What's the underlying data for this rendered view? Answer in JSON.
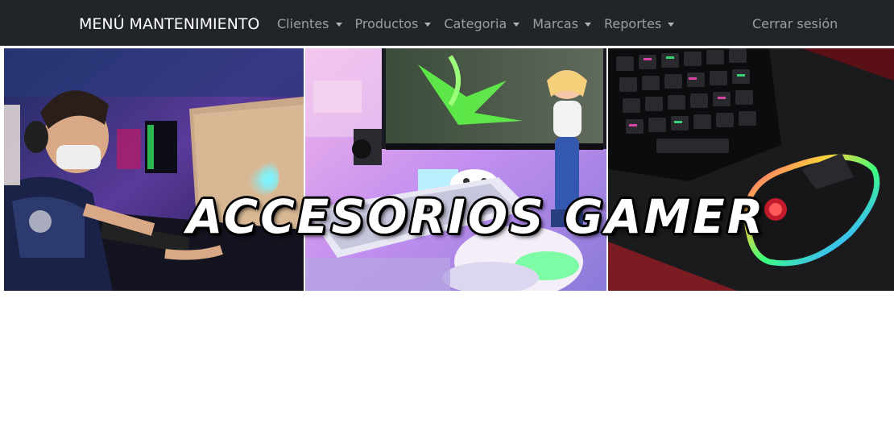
{
  "navbar": {
    "brand": "MENÚ MANTENIMIENTO",
    "items": [
      {
        "label": "Clientes"
      },
      {
        "label": "Productos"
      },
      {
        "label": "Categoria"
      },
      {
        "label": "Marcas"
      },
      {
        "label": "Reportes"
      }
    ],
    "logout_label": "Cerrar sesión"
  },
  "banner": {
    "title": "ACCESORIOS GAMER"
  },
  "colors": {
    "navbar_bg": "#212529",
    "nav_text": "#8c8f92",
    "brand_text": "#ffffff"
  }
}
